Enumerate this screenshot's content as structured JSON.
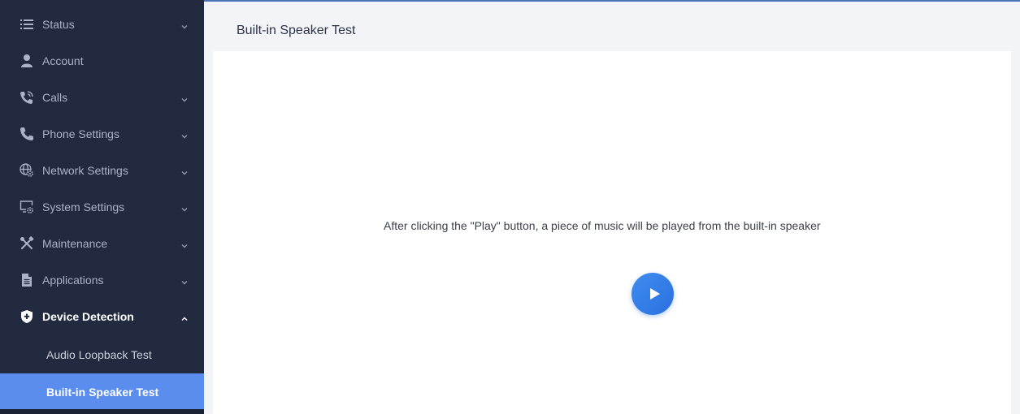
{
  "sidebar": {
    "items": [
      {
        "label": "Status",
        "icon": "list-icon",
        "chevron": "down"
      },
      {
        "label": "Account",
        "icon": "user-icon",
        "chevron": ""
      },
      {
        "label": "Calls",
        "icon": "phone-ringing-icon",
        "chevron": "down"
      },
      {
        "label": "Phone Settings",
        "icon": "phone-icon",
        "chevron": "down"
      },
      {
        "label": "Network Settings",
        "icon": "network-gear-icon",
        "chevron": "down"
      },
      {
        "label": "System Settings",
        "icon": "monitor-gear-icon",
        "chevron": "down"
      },
      {
        "label": "Maintenance",
        "icon": "tools-icon",
        "chevron": "down"
      },
      {
        "label": "Applications",
        "icon": "document-icon",
        "chevron": "down"
      },
      {
        "label": "Device Detection",
        "icon": "shield-plus-icon",
        "chevron": "up"
      }
    ],
    "subitems": [
      {
        "label": "Audio Loopback Test"
      },
      {
        "label": "Built-in Speaker Test"
      }
    ]
  },
  "main": {
    "title": "Built-in Speaker Test",
    "hint": "After clicking the \"Play\" button, a piece of music will be played from the built-in speaker",
    "play_button": "play-icon"
  },
  "colors": {
    "sidebar_bg": "#222a3f",
    "selected_bg": "#5b8def",
    "accent": "#2a6fe0",
    "content_bg": "#f2f4f7"
  }
}
